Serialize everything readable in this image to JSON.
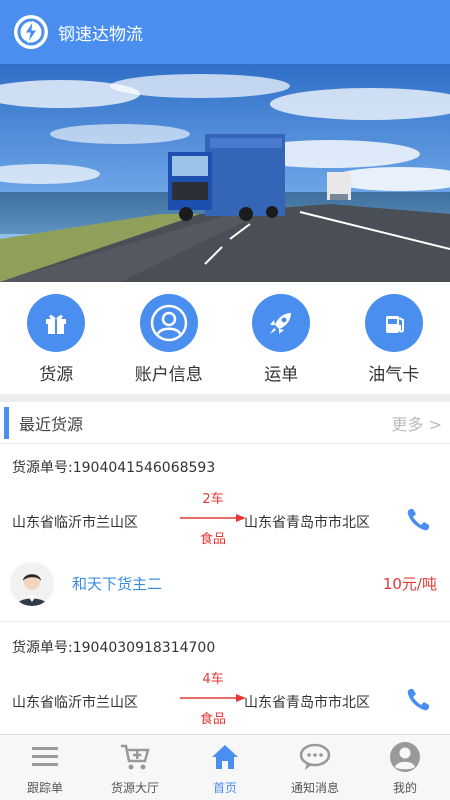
{
  "header": {
    "title": "钢速达物流"
  },
  "quick": [
    {
      "label": "货源",
      "icon": "gift-icon"
    },
    {
      "label": "账户信息",
      "icon": "user-icon"
    },
    {
      "label": "运单",
      "icon": "rocket-icon"
    },
    {
      "label": "油气卡",
      "icon": "fuel-card-icon"
    }
  ],
  "section": {
    "title": "最近货源",
    "more": "更多 >"
  },
  "cargo": [
    {
      "no_label": "货源单号:1904041546068593",
      "from": "山东省临沂市兰山区",
      "to": "山东省青岛市市北区",
      "count": "2车",
      "goods": "食品",
      "owner": "和天下货主二",
      "price": "10元/吨"
    },
    {
      "no_label": "货源单号:1904030918314700",
      "from": "山东省临沂市兰山区",
      "to": "山东省青岛市市北区",
      "count": "4车",
      "goods": "食品"
    }
  ],
  "tabs": [
    {
      "label": "跟踪单",
      "icon": "list-icon",
      "active": false
    },
    {
      "label": "货源大厅",
      "icon": "cart-plus-icon",
      "active": false
    },
    {
      "label": "首页",
      "icon": "home-icon",
      "active": true
    },
    {
      "label": "通知消息",
      "icon": "chat-icon",
      "active": false
    },
    {
      "label": "我的",
      "icon": "profile-icon",
      "active": false
    }
  ],
  "colors": {
    "primary": "#4a8ff0",
    "accent_red": "#e53935",
    "owner_blue": "#3a8fe0"
  }
}
